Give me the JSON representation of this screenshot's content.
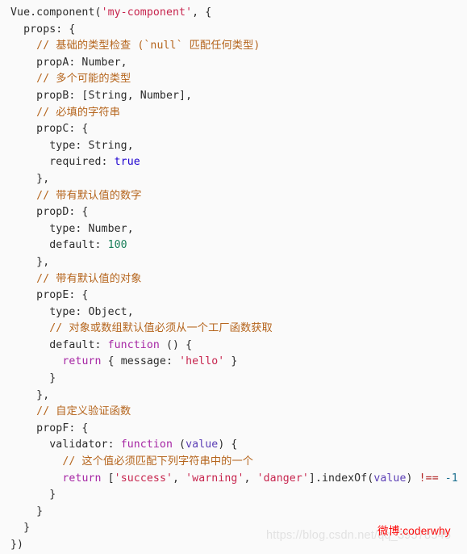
{
  "document": {
    "language": "javascript",
    "background_color": "#fafafa",
    "theme": "light"
  },
  "colors": {
    "plain": "#2b2b2b",
    "comment": "#b5651d",
    "string": "#c7254e",
    "keyword": "#a626a4",
    "number": "#1a7f5a",
    "boolean": "#1c00cf",
    "parameter": "#5b3eb5",
    "operator": "#b02020",
    "watermark_red": "#fa0a0a",
    "watermark_gray": "#e2e2e2"
  },
  "watermarks": {
    "csdn": "https://blog.csdn.net/qq_39578545",
    "weibo": "微博:coderwhy"
  },
  "code": {
    "lines": [
      [
        {
          "t": "plain",
          "v": "Vue.component("
        },
        {
          "t": "string",
          "v": "'my-component'"
        },
        {
          "t": "plain",
          "v": ", {"
        }
      ],
      [
        {
          "t": "plain",
          "v": "  props: {"
        }
      ],
      [
        {
          "t": "comment",
          "v": "    // 基础的类型检查 (`null` 匹配任何类型)"
        }
      ],
      [
        {
          "t": "plain",
          "v": "    propA: Number,"
        }
      ],
      [
        {
          "t": "comment",
          "v": "    // 多个可能的类型"
        }
      ],
      [
        {
          "t": "plain",
          "v": "    propB: [String, Number],"
        }
      ],
      [
        {
          "t": "comment",
          "v": "    // 必填的字符串"
        }
      ],
      [
        {
          "t": "plain",
          "v": "    propC: {"
        }
      ],
      [
        {
          "t": "plain",
          "v": "      type: String,"
        }
      ],
      [
        {
          "t": "plain",
          "v": "      required: "
        },
        {
          "t": "bool",
          "v": "true"
        }
      ],
      [
        {
          "t": "plain",
          "v": "    },"
        }
      ],
      [
        {
          "t": "comment",
          "v": "    // 带有默认值的数字"
        }
      ],
      [
        {
          "t": "plain",
          "v": "    propD: {"
        }
      ],
      [
        {
          "t": "plain",
          "v": "      type: Number,"
        }
      ],
      [
        {
          "t": "plain",
          "v": "      default: "
        },
        {
          "t": "number",
          "v": "100"
        }
      ],
      [
        {
          "t": "plain",
          "v": "    },"
        }
      ],
      [
        {
          "t": "comment",
          "v": "    // 带有默认值的对象"
        }
      ],
      [
        {
          "t": "plain",
          "v": "    propE: {"
        }
      ],
      [
        {
          "t": "plain",
          "v": "      type: Object,"
        }
      ],
      [
        {
          "t": "comment",
          "v": "      // 对象或数组默认值必须从一个工厂函数获取"
        }
      ],
      [
        {
          "t": "plain",
          "v": "      default: "
        },
        {
          "t": "keyword",
          "v": "function"
        },
        {
          "t": "plain",
          "v": " () {"
        }
      ],
      [
        {
          "t": "plain",
          "v": "        "
        },
        {
          "t": "keyword",
          "v": "return"
        },
        {
          "t": "plain",
          "v": " { message: "
        },
        {
          "t": "string",
          "v": "'hello'"
        },
        {
          "t": "plain",
          "v": " }"
        }
      ],
      [
        {
          "t": "plain",
          "v": "      }"
        }
      ],
      [
        {
          "t": "plain",
          "v": "    },"
        }
      ],
      [
        {
          "t": "comment",
          "v": "    // 自定义验证函数"
        }
      ],
      [
        {
          "t": "plain",
          "v": "    propF: {"
        }
      ],
      [
        {
          "t": "plain",
          "v": "      validator: "
        },
        {
          "t": "keyword",
          "v": "function"
        },
        {
          "t": "plain",
          "v": " ("
        },
        {
          "t": "param",
          "v": "value"
        },
        {
          "t": "plain",
          "v": ") {"
        }
      ],
      [
        {
          "t": "comment",
          "v": "        // 这个值必须匹配下列字符串中的一个"
        }
      ],
      [
        {
          "t": "plain",
          "v": "        "
        },
        {
          "t": "keyword",
          "v": "return"
        },
        {
          "t": "plain",
          "v": " ["
        },
        {
          "t": "string",
          "v": "'success'"
        },
        {
          "t": "plain",
          "v": ", "
        },
        {
          "t": "string",
          "v": "'warning'"
        },
        {
          "t": "plain",
          "v": ", "
        },
        {
          "t": "string",
          "v": "'danger'"
        },
        {
          "t": "plain",
          "v": "].indexOf("
        },
        {
          "t": "param",
          "v": "value"
        },
        {
          "t": "plain",
          "v": ") "
        },
        {
          "t": "op",
          "v": "!=="
        },
        {
          "t": "plain",
          "v": " "
        },
        {
          "t": "numneg",
          "v": "-1"
        }
      ],
      [
        {
          "t": "plain",
          "v": "      }"
        }
      ],
      [
        {
          "t": "plain",
          "v": "    }"
        }
      ],
      [
        {
          "t": "plain",
          "v": "  }"
        }
      ],
      [
        {
          "t": "plain",
          "v": "})"
        }
      ]
    ]
  }
}
